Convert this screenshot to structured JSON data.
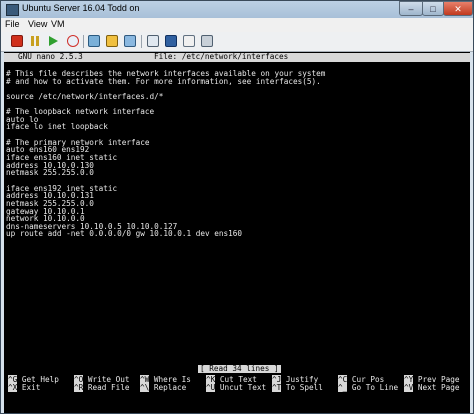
{
  "window": {
    "title": "Ubuntu Server 16.04 Todd on",
    "min_glyph": "–",
    "max_glyph": "□",
    "close_glyph": "✕"
  },
  "menubar": [
    "File",
    "View",
    "VM"
  ],
  "toolbar": {
    "icons": [
      "stop-icon",
      "pause-icon",
      "play-icon",
      "reset-icon",
      "snapshot-icon",
      "revert-icon",
      "manage-snapshots-icon",
      "settings-icon",
      "console-icon",
      "network-icon",
      "usb-icon"
    ]
  },
  "nano": {
    "version": "GNU nano 2.5.3",
    "file": "File: /etc/network/interfaces",
    "lines": [
      "# This file describes the network interfaces available on your system",
      "# and how to activate them. For more information, see interfaces(5).",
      "",
      "source /etc/network/interfaces.d/*",
      "",
      "# The loopback network interface",
      "auto lo",
      "iface lo inet loopback",
      "",
      "# The primary network interface",
      "auto ens160 ens192",
      "iface ens160 inet static",
      "address 10.10.0.130",
      "netmask 255.255.0.0",
      "",
      "iface ens192 inet static",
      "address 10.10.0.131",
      "netmask 255.255.0.0",
      "gateway 10.10.0.1",
      "network 10.10.0.0",
      "dns-nameservers 10.10.0.5 10.10.0.127",
      "up route add -net 0.0.0.0/0 gw 10.10.0.1 dev ens160"
    ],
    "status": "[ Read 34 lines ]",
    "shortcuts_row1": [
      {
        "key": "^G",
        "label": "Get Help"
      },
      {
        "key": "^O",
        "label": "Write Out"
      },
      {
        "key": "^W",
        "label": "Where Is"
      },
      {
        "key": "^K",
        "label": "Cut Text"
      },
      {
        "key": "^J",
        "label": "Justify"
      },
      {
        "key": "^C",
        "label": "Cur Pos"
      },
      {
        "key": "^Y",
        "label": "Prev Page"
      }
    ],
    "shortcuts_row2": [
      {
        "key": "^X",
        "label": "Exit"
      },
      {
        "key": "^R",
        "label": "Read File"
      },
      {
        "key": "^\\",
        "label": "Replace"
      },
      {
        "key": "^U",
        "label": "Uncut Text"
      },
      {
        "key": "^T",
        "label": "To Spell"
      },
      {
        "key": "^_",
        "label": "Go To Line"
      },
      {
        "key": "^V",
        "label": "Next Page"
      }
    ]
  },
  "colors": {
    "terminal_bg": "#000000",
    "terminal_fg": "#e8e8e8",
    "nano_bar": "#d8d8d8",
    "close_button": "#c03a20"
  }
}
